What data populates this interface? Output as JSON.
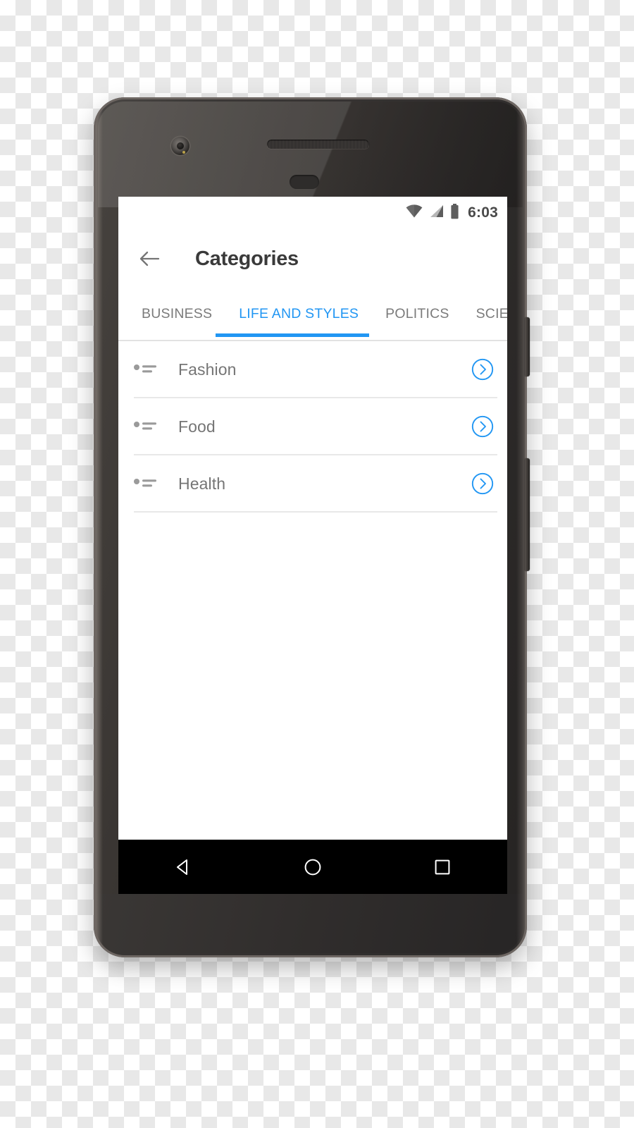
{
  "device": {
    "name": "android-phone-mockup",
    "hardware": {
      "front_camera": "front-camera",
      "earpiece": "earpiece-speaker",
      "proximity_sensor": "proximity-sensor",
      "power_button": "power-button",
      "volume_button": "volume-button"
    }
  },
  "colors": {
    "accent_blue": "#2196f3",
    "title_text": "#3a3a3a",
    "body_text": "#757575",
    "tab_inactive": "#7b7b7b",
    "divider": "#e8e8e8",
    "nav_bar_bg": "#000000",
    "screen_bg": "#ffffff"
  },
  "status_bar": {
    "time": "6:03",
    "icons": [
      "wifi-icon",
      "cellular-signal-icon",
      "battery-icon"
    ]
  },
  "app_bar": {
    "back_icon": "back-arrow-icon",
    "title": "Categories"
  },
  "tabs": {
    "active_index": 1,
    "items": [
      {
        "label": "BUSINESS",
        "active": false
      },
      {
        "label": "LIFE AND STYLES",
        "active": true
      },
      {
        "label": "POLITICS",
        "active": false
      },
      {
        "label": "SCIENCE",
        "active": false
      }
    ]
  },
  "list": {
    "rows": [
      {
        "label": "Fashion",
        "leading_icon": "bullet-list-icon",
        "trailing_icon": "chevron-right-circle-icon"
      },
      {
        "label": "Food",
        "leading_icon": "bullet-list-icon",
        "trailing_icon": "chevron-right-circle-icon"
      },
      {
        "label": "Health",
        "leading_icon": "bullet-list-icon",
        "trailing_icon": "chevron-right-circle-icon"
      }
    ]
  },
  "nav_bar": {
    "keys": [
      {
        "name": "back-nav-button",
        "icon": "triangle-left-icon"
      },
      {
        "name": "home-nav-button",
        "icon": "circle-icon"
      },
      {
        "name": "recents-nav-button",
        "icon": "square-icon"
      }
    ]
  }
}
